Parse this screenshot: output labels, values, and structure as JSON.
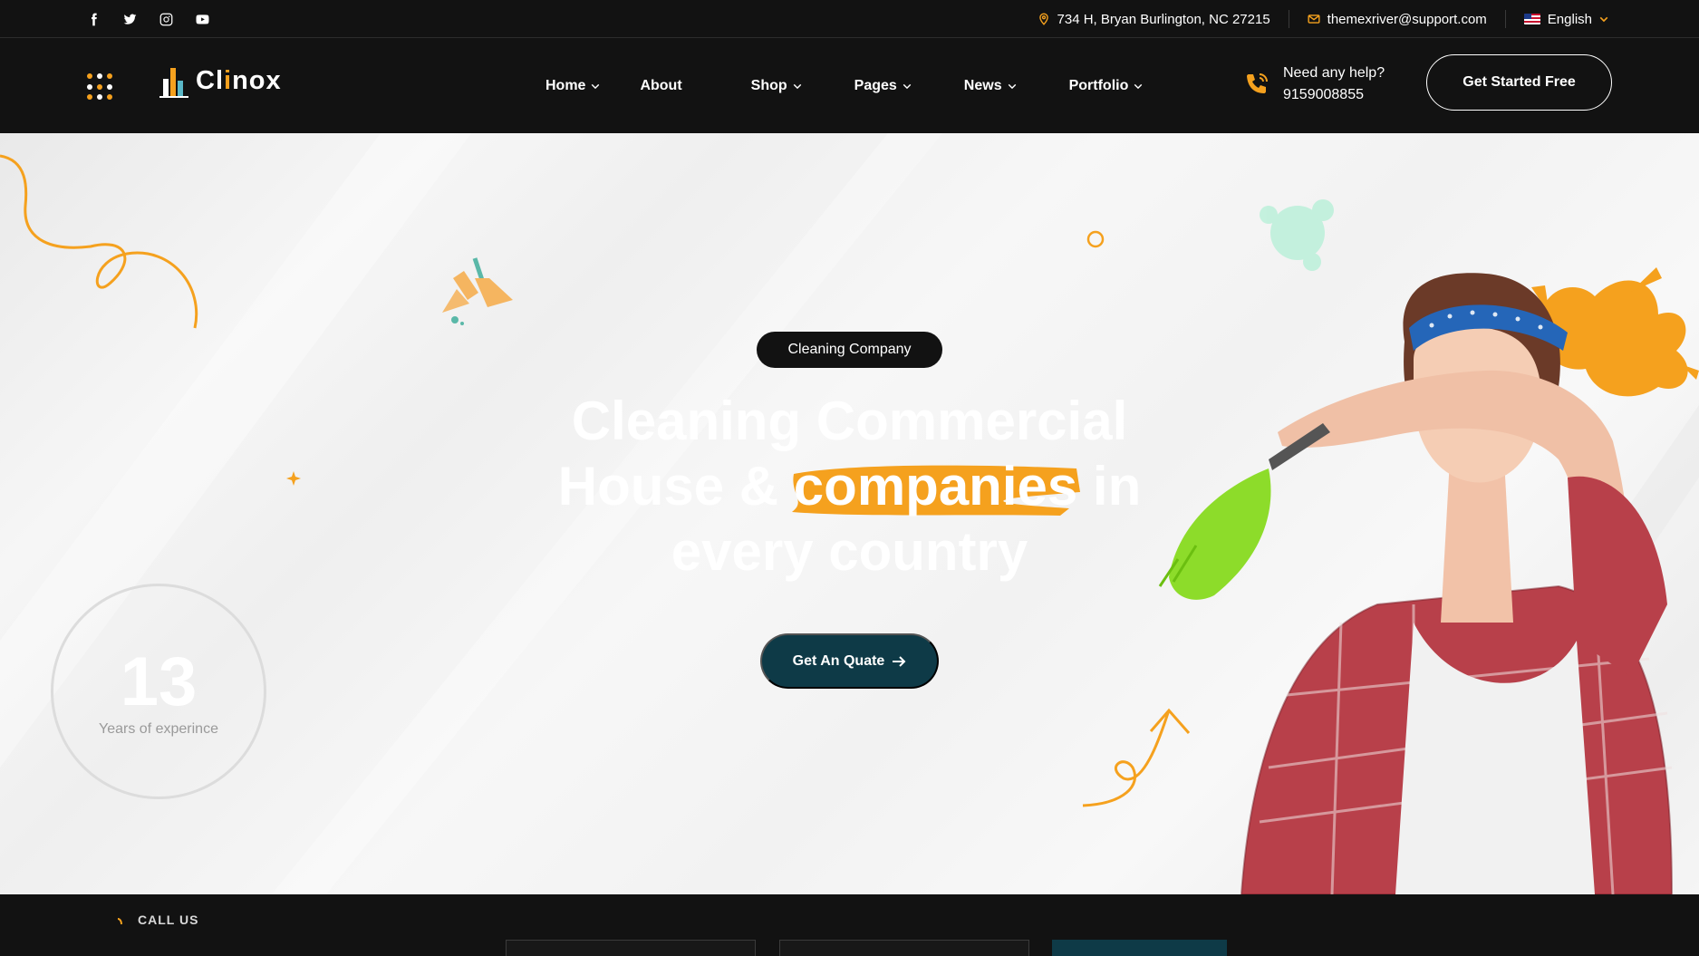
{
  "topbar": {
    "social": [
      "facebook-icon",
      "twitter-icon",
      "instagram-icon",
      "youtube-icon"
    ],
    "address": "734 H, Bryan Burlington, NC 27215",
    "email": "themexriver@support.com",
    "language": "English"
  },
  "header": {
    "logo_prefix": "Cl",
    "logo_accent": "i",
    "logo_suffix": "nox",
    "nav": [
      {
        "label": "Home",
        "dropdown": true
      },
      {
        "label": "About",
        "dropdown": false
      },
      {
        "label": "Shop",
        "dropdown": true
      },
      {
        "label": "Pages",
        "dropdown": true
      },
      {
        "label": "News",
        "dropdown": true
      },
      {
        "label": "Portfolio",
        "dropdown": true
      }
    ],
    "help_label": "Need any help?",
    "help_phone": "9159008855",
    "cta_label": "Get Started Free"
  },
  "hero": {
    "badge": "Cleaning Company",
    "title_line1": "Cleaning Commercial",
    "title_line2_start": "House &",
    "title_highlight": "companies",
    "title_line2_end": "in",
    "title_line3": "every country",
    "button_label": "Get An Quate",
    "years_number": "13",
    "years_label": "Years of experince"
  },
  "bottom": {
    "call_label": "CALL US"
  },
  "colors": {
    "accent": "#f5a11e",
    "dark": "#121212",
    "teal": "#0e3a47",
    "hero_bg": "#f3f3f3"
  }
}
